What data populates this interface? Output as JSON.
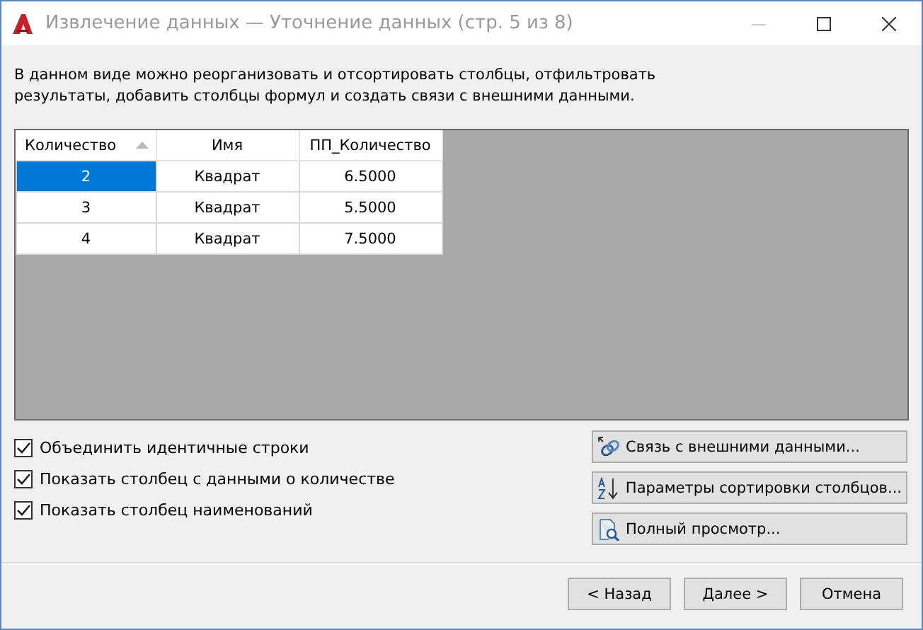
{
  "window": {
    "title": "Извлечение данных — Уточнение данных (стр. 5 из 8)"
  },
  "description": "В данном виде можно реорганизовать и отсортировать столбцы, отфильтровать результаты, добавить столбцы формул и создать связи с внешними данными.",
  "table": {
    "columns": [
      {
        "label": "Количество",
        "sorted": true
      },
      {
        "label": "Имя",
        "sorted": false
      },
      {
        "label": "ПП_Количество",
        "sorted": false
      }
    ],
    "rows": [
      {
        "cells": [
          "2",
          "Квадрат",
          "6.5000"
        ],
        "selected": true
      },
      {
        "cells": [
          "3",
          "Квадрат",
          "5.5000"
        ],
        "selected": false
      },
      {
        "cells": [
          "4",
          "Квадрат",
          "7.5000"
        ],
        "selected": false
      }
    ]
  },
  "options": [
    {
      "label": "Объединить идентичные строки",
      "checked": true
    },
    {
      "label": "Показать столбец с данными о количестве",
      "checked": true
    },
    {
      "label": "Показать столбец наименований",
      "checked": true
    }
  ],
  "actions": [
    {
      "label": "Связь с внешними данными...",
      "kind": "link"
    },
    {
      "label": "Параметры сортировки столбцов...",
      "kind": "sort"
    },
    {
      "label": "Полный просмотр...",
      "kind": "preview"
    }
  ],
  "buttons": [
    "< Назад",
    "Далее >",
    "Отмена"
  ]
}
